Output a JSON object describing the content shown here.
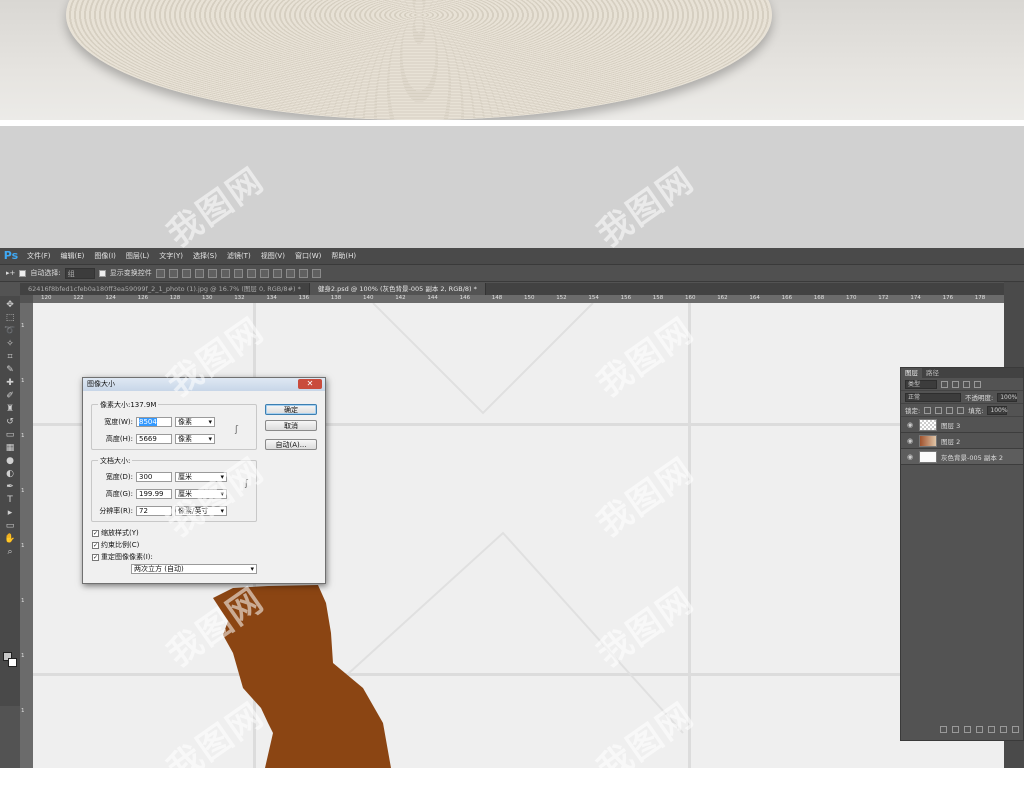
{
  "menubar": {
    "logo": "Ps",
    "items": [
      "文件(F)",
      "编辑(E)",
      "图像(I)",
      "图层(L)",
      "文字(Y)",
      "选择(S)",
      "滤镜(T)",
      "视图(V)",
      "窗口(W)",
      "帮助(H)"
    ]
  },
  "options": {
    "auto_select_label": "自动选择:",
    "auto_select_value": "组",
    "transform_label": "显示变换控件"
  },
  "tabs": [
    {
      "label": "62416f8bfed1cfeb0a180ff3ea59099f_2_1_photo (1).jpg @ 16.7% (图层 0, RGB/8#) *"
    },
    {
      "label": "健身2.psd @ 100% (灰色背景-005 副本 2, RGB/8) *"
    }
  ],
  "ruler_top": [
    "120",
    "122",
    "124",
    "126",
    "128",
    "130",
    "132",
    "134",
    "136",
    "138",
    "140",
    "142",
    "144",
    "146",
    "148",
    "150",
    "152",
    "154",
    "156",
    "158",
    "160",
    "162",
    "164",
    "166",
    "168",
    "170",
    "172",
    "174",
    "176",
    "178"
  ],
  "ruler_left": [
    "1",
    "1",
    "1",
    "1",
    "1",
    "1",
    "1",
    "1"
  ],
  "dialog": {
    "title": "图像大小",
    "pixel_group_title": "像素大小:137.9M",
    "width_label": "宽度(W):",
    "width_value": "8504",
    "width_unit": "像素",
    "height_label": "高度(H):",
    "height_value": "5669",
    "height_unit": "像素",
    "doc_group_title": "文档大小:",
    "doc_width_label": "宽度(D):",
    "doc_width_value": "300",
    "doc_width_unit": "厘米",
    "doc_height_label": "高度(G):",
    "doc_height_value": "199.99",
    "doc_height_unit": "厘米",
    "res_label": "分辨率(R):",
    "res_value": "72",
    "res_unit": "像素/英寸",
    "ok_label": "确定",
    "cancel_label": "取消",
    "auto_label": "自动(A)...",
    "scale_styles_label": "缩放样式(Y)",
    "constrain_label": "约束比例(C)",
    "resample_label": "重定图像像素(I):",
    "resample_method": "两次立方 (自动)"
  },
  "layers_panel": {
    "tab_layers": "图层",
    "tab_paths": "路径",
    "kind_label": "类型",
    "blend_mode": "正常",
    "opacity_label": "不透明度:",
    "opacity_value": "100%",
    "lock_label": "锁定:",
    "fill_label": "填充:",
    "fill_value": "100%",
    "layers": [
      {
        "name": "图层 3"
      },
      {
        "name": "图层 2"
      },
      {
        "name": "灰色背景-005 副本 2"
      }
    ]
  },
  "watermark": "我图网",
  "colors": {
    "silhouette": "#8B4513",
    "ps_accent": "#3fa9f5"
  }
}
